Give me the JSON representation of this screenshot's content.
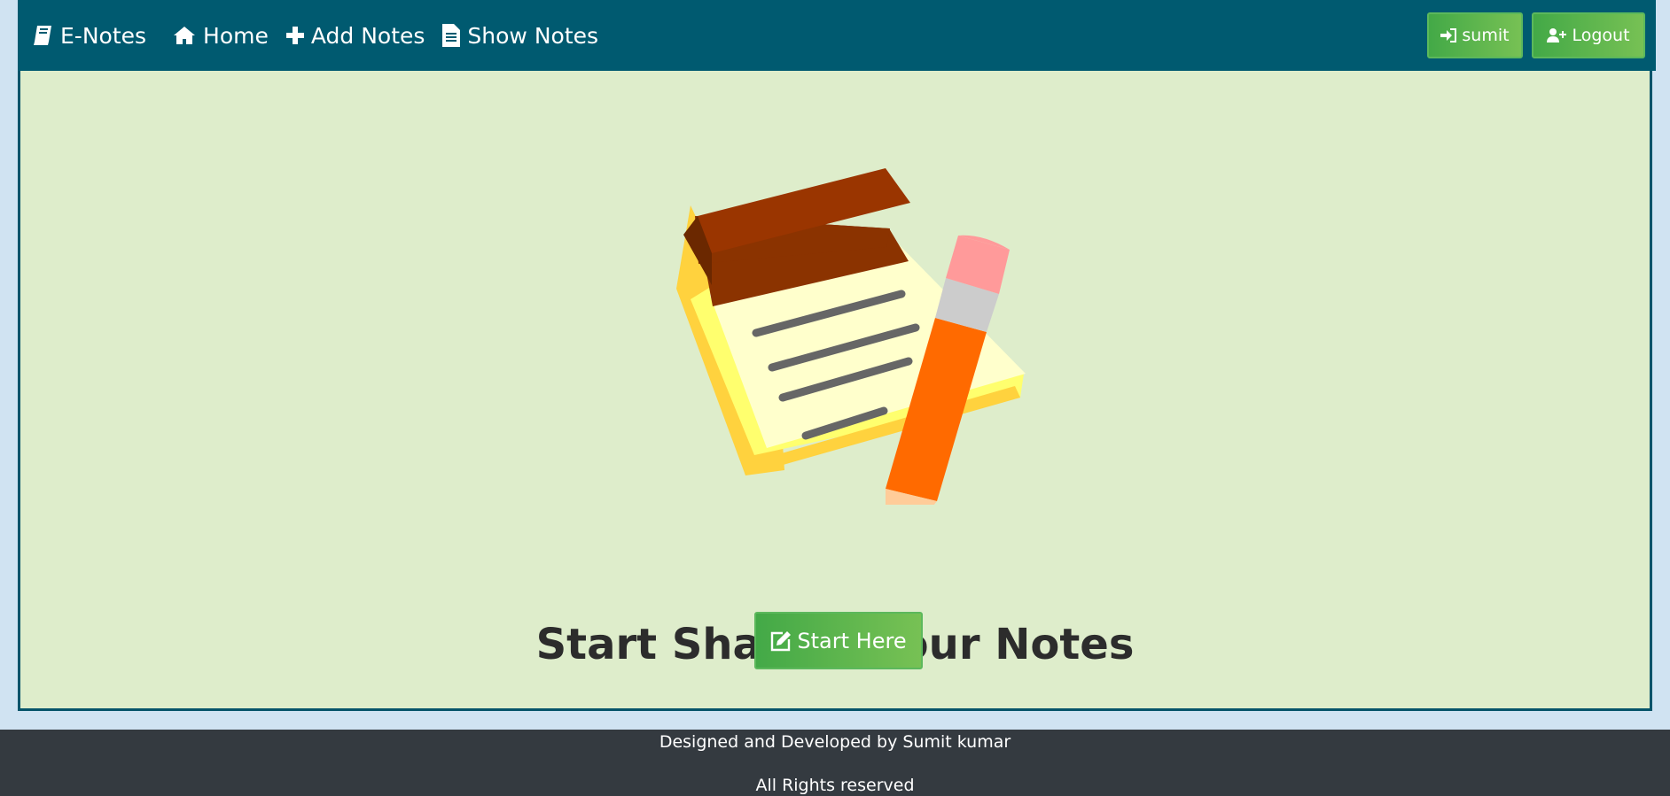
{
  "navbar": {
    "brand": {
      "label": "E-Notes",
      "icon": "book-icon"
    },
    "links": [
      {
        "label": "Home",
        "icon": "home-icon"
      },
      {
        "label": "Add Notes",
        "icon": "plus-icon"
      },
      {
        "label": "Show Notes",
        "icon": "file-icon"
      }
    ],
    "user_button": {
      "label": "sumit",
      "icon": "sign-in-icon"
    },
    "logout_button": {
      "label": "Logout",
      "icon": "user-plus-icon"
    }
  },
  "hero": {
    "image": "notepad-pencil-illustration",
    "headline": "Start Sharing Your Notes",
    "cta": {
      "label": "Start Here",
      "icon": "edit-icon"
    }
  },
  "footer": {
    "credit": "Designed and Developed by Sumit kumar",
    "rights": "All Rights reserved"
  },
  "colors": {
    "navbar_bg": "#005a70",
    "page_bg": "#d0e3f2",
    "main_bg": "#deedcb",
    "button_green": "#5cb85c",
    "footer_bg": "#343a40"
  }
}
